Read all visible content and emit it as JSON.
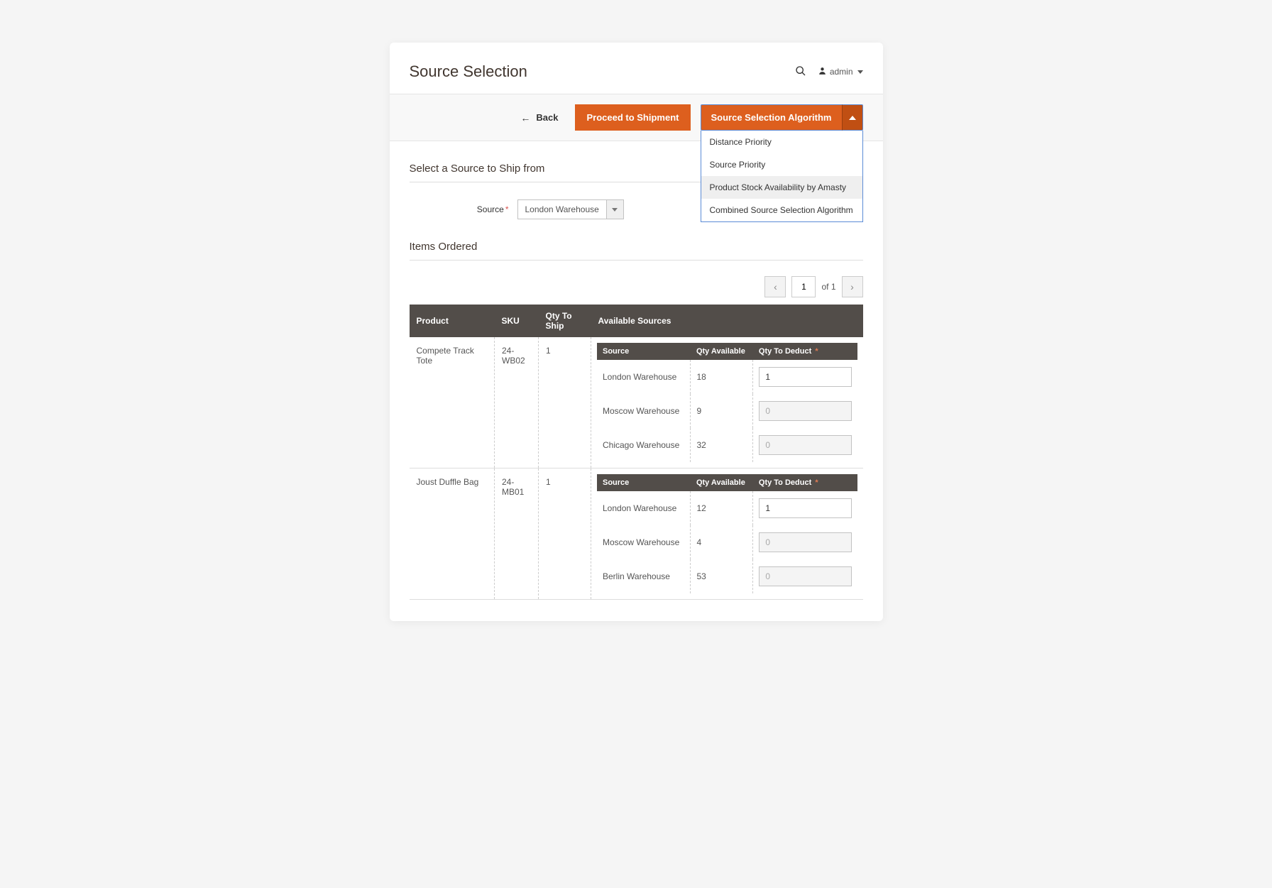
{
  "header": {
    "title": "Source Selection",
    "user_label": "admin"
  },
  "toolbar": {
    "back_label": "Back",
    "proceed_label": "Proceed to Shipment",
    "algo_label": "Source Selection Algorithm",
    "algo_options": [
      {
        "label": "Distance Priority",
        "highlighted": false
      },
      {
        "label": "Source Priority",
        "highlighted": false
      },
      {
        "label": "Product Stock Availability by Amasty",
        "highlighted": true
      },
      {
        "label": "Combined Source Selection Algorithm",
        "highlighted": false
      }
    ]
  },
  "select_source": {
    "section_title": "Select a Source to Ship from",
    "field_label": "Source",
    "selected": "London Warehouse"
  },
  "items_ordered": {
    "section_title": "Items Ordered",
    "pagination": {
      "current": "1",
      "of_label": "of 1"
    },
    "columns": {
      "product": "Product",
      "sku": "SKU",
      "qty_to_ship": "Qty To Ship",
      "available_sources": "Available Sources",
      "inner_source": "Source",
      "inner_qty_available": "Qty Available",
      "inner_qty_to_deduct": "Qty To Deduct"
    },
    "rows": [
      {
        "product": "Compete Track Tote",
        "sku": "24-WB02",
        "qty_to_ship": "1",
        "sources": [
          {
            "name": "London Warehouse",
            "qty_available": "18",
            "qty_to_deduct": "1",
            "disabled": false
          },
          {
            "name": "Moscow Warehouse",
            "qty_available": "9",
            "qty_to_deduct": "0",
            "disabled": true
          },
          {
            "name": "Chicago Warehouse",
            "qty_available": "32",
            "qty_to_deduct": "0",
            "disabled": true
          }
        ]
      },
      {
        "product": "Joust Duffle Bag",
        "sku": "24-MB01",
        "qty_to_ship": "1",
        "sources": [
          {
            "name": "London Warehouse",
            "qty_available": "12",
            "qty_to_deduct": "1",
            "disabled": false
          },
          {
            "name": "Moscow Warehouse",
            "qty_available": "4",
            "qty_to_deduct": "0",
            "disabled": true
          },
          {
            "name": "Berlin Warehouse",
            "qty_available": "53",
            "qty_to_deduct": "0",
            "disabled": true
          }
        ]
      }
    ]
  }
}
